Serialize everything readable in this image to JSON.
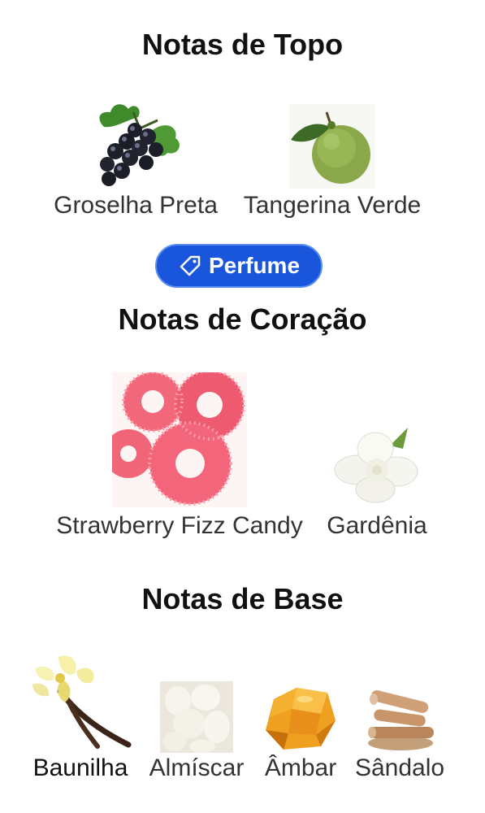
{
  "sections": {
    "top": {
      "title": "Notas de Topo",
      "notes": [
        {
          "label": "Groselha Preta",
          "icon": "blackcurrant-icon"
        },
        {
          "label": "Tangerina Verde",
          "icon": "green-tangerine-icon"
        }
      ]
    },
    "heart": {
      "title": "Notas de Coração",
      "notes": [
        {
          "label": "Strawberry Fizz Candy",
          "icon": "strawberry-candy-icon"
        },
        {
          "label": "Gardênia",
          "icon": "gardenia-icon"
        }
      ]
    },
    "base": {
      "title": "Notas de Base",
      "notes": [
        {
          "label": "Baunilha",
          "icon": "vanilla-icon"
        },
        {
          "label": "Almíscar",
          "icon": "musk-icon"
        },
        {
          "label": "Âmbar",
          "icon": "amber-icon"
        },
        {
          "label": "Sândalo",
          "icon": "sandalwood-icon"
        }
      ]
    }
  },
  "tag": {
    "label": "Perfume",
    "icon": "tag-icon",
    "color": "#1a56db"
  },
  "colors": {
    "title": "#111111",
    "label": "#333333",
    "label_dark": "#111111"
  }
}
